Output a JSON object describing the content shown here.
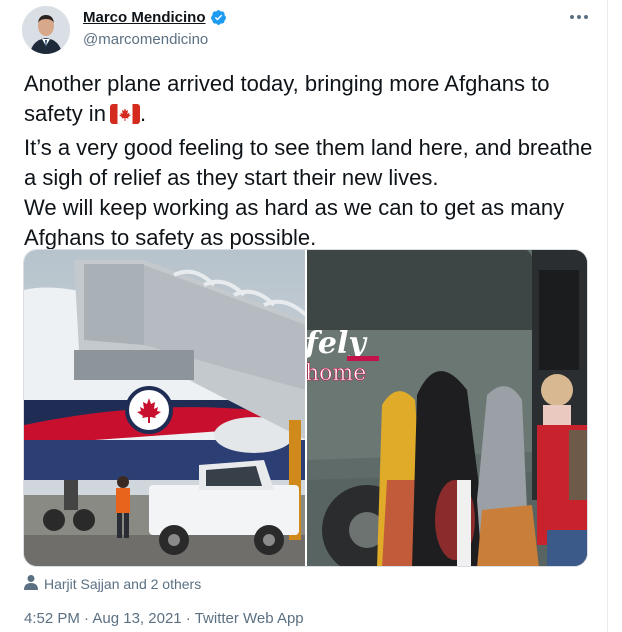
{
  "author": {
    "display_name": "Marco Mendicino",
    "handle": "@marcomendicino",
    "verified": true
  },
  "tweet": {
    "line1": "Another plane arrived today, bringing more Afghans to",
    "line2": "safety in",
    "flag_icon": "canada-flag",
    "line2_end": ".",
    "para2": "It’s a very good feeling to see them land here, and breathe a sigh of relief as they start their new lives.",
    "para3": "We will keep working as hard as we can to get as many Afghans to safety as possible."
  },
  "media": {
    "image1": "airplane-with-jet-bridge",
    "image2": "people-boarding-bus",
    "bus_sign_line1": "fely",
    "bus_sign_line2": "home"
  },
  "tagged": {
    "text": "Harjit Sajjan and 2 others",
    "icon": "person-icon"
  },
  "meta": {
    "time": "4:52 PM",
    "sep1": " · ",
    "date": "Aug 13, 2021",
    "sep2": " · ",
    "source": "Twitter Web App"
  },
  "colors": {
    "verified": "#1d9bf0",
    "secondary_text": "#5b7083",
    "text": "#0f1419"
  }
}
